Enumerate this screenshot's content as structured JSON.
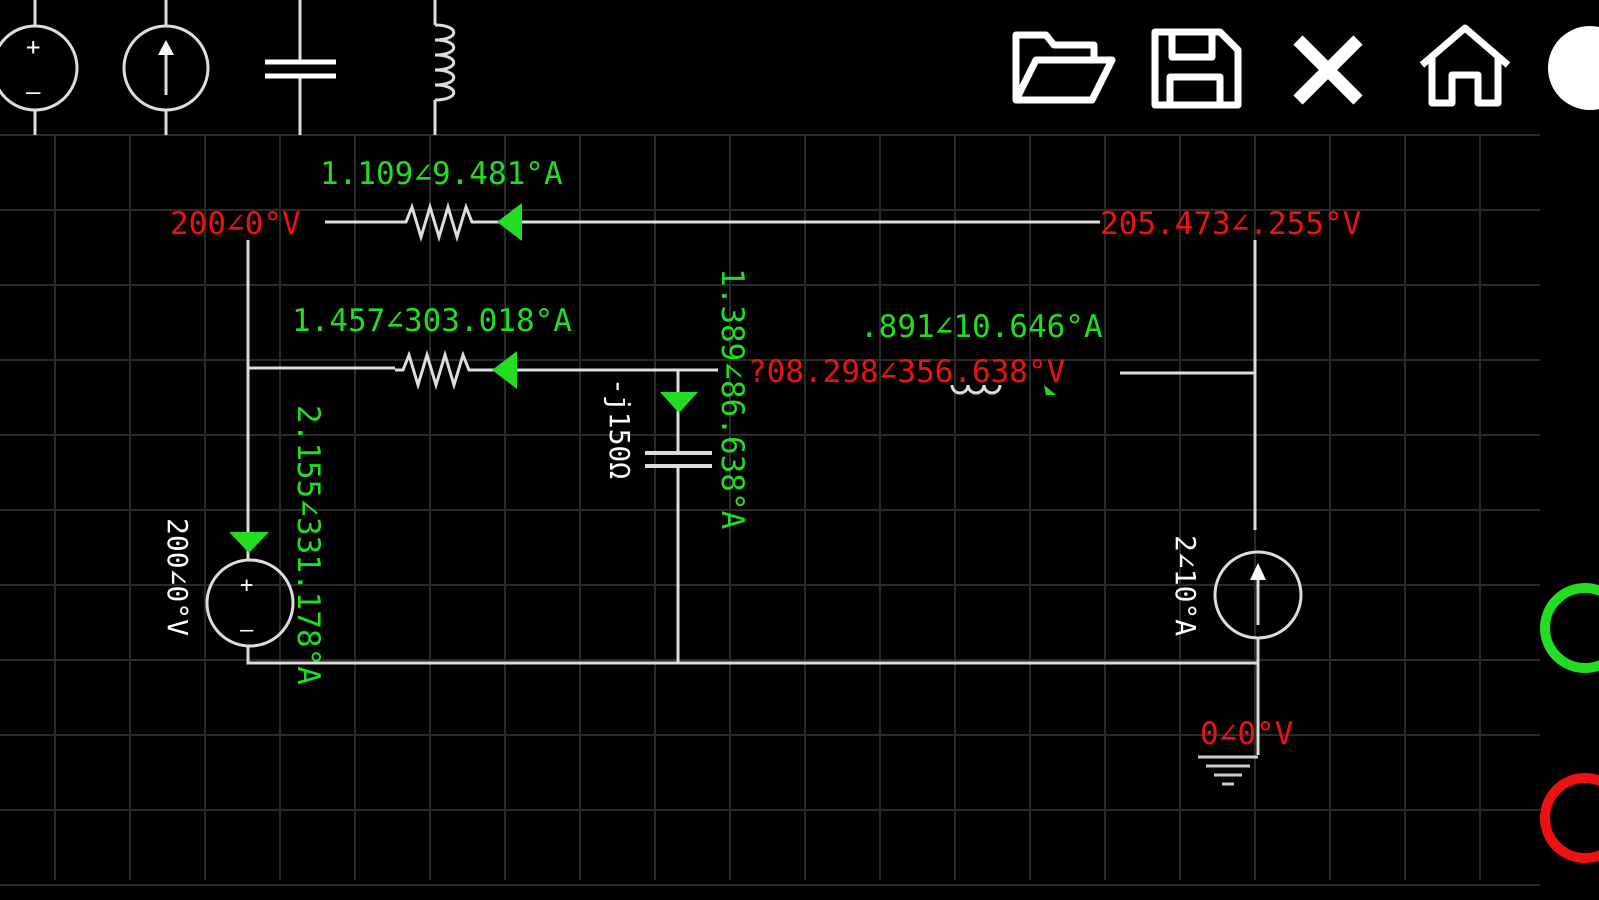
{
  "toolbar": {
    "components": [
      "voltage-source",
      "current-source",
      "capacitor",
      "inductor"
    ],
    "actions": [
      "open",
      "save",
      "close",
      "home"
    ]
  },
  "circuit": {
    "node_voltages": {
      "top_left": "200∠0°V",
      "top_right": "205.473∠.255°V",
      "middle_right": "?08.298∠356.638°V",
      "ground": "0∠0°V"
    },
    "currents": {
      "top_resistor": "1.109∠9.481°A",
      "middle_resistor": "1.457∠303.018°A",
      "capacitor": "1.389∠86.638°A",
      "inductor": ".891∠10.646°A",
      "voltage_source": "2.155∠331.178°A"
    },
    "components": {
      "capacitor_impedance": "-j150Ω",
      "voltage_source_value": "200∠0°V",
      "current_source_value": "2∠10°A"
    }
  },
  "colors": {
    "current": "#22dd22",
    "voltage": "#ee1111",
    "wire": "#dddddd",
    "grid": "#2a2a2a"
  }
}
